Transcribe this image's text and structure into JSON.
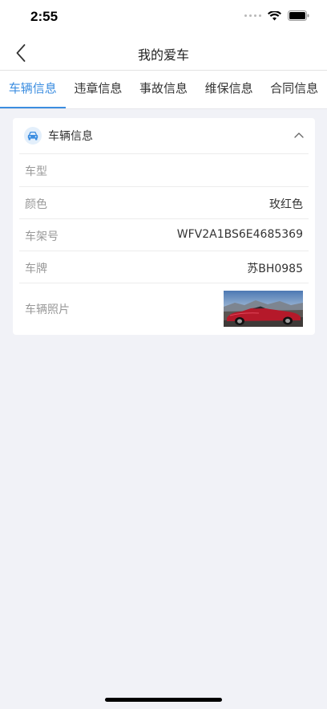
{
  "status_bar": {
    "time": "2:55"
  },
  "nav": {
    "title": "我的爱车"
  },
  "tabs": [
    {
      "label": "车辆信息",
      "active": true
    },
    {
      "label": "违章信息",
      "active": false
    },
    {
      "label": "事故信息",
      "active": false
    },
    {
      "label": "维保信息",
      "active": false
    },
    {
      "label": "合同信息",
      "active": false
    }
  ],
  "card": {
    "title": "车辆信息",
    "rows": [
      {
        "label": "车型",
        "value": ""
      },
      {
        "label": "颜色",
        "value": "玫红色"
      },
      {
        "label": "车架号",
        "value": "WFV2A1BS6E4685369"
      },
      {
        "label": "车牌",
        "value": "苏BH0985"
      },
      {
        "label": "车辆照片",
        "value": ""
      }
    ]
  },
  "colors": {
    "accent": "#3b8de0",
    "page_background": "#f1f2f7",
    "car_color": "#b5192a"
  },
  "icons": {
    "back": "chevron-left-icon",
    "card": "car-icon",
    "collapse": "chevron-up-icon"
  }
}
